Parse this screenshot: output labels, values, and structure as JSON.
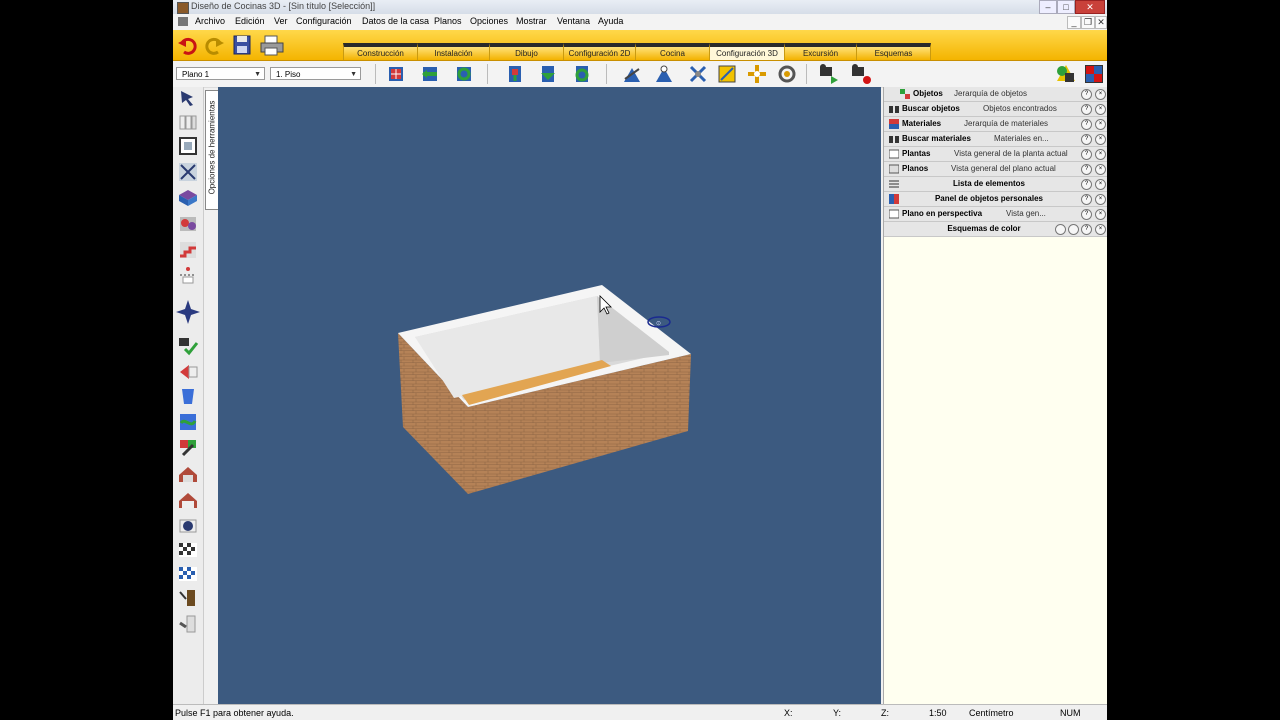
{
  "window": {
    "title": "Diseño de Cocinas 3D - [Sin título [Selección]]",
    "min_label": "–",
    "max_label": "□",
    "close_label": "✕"
  },
  "menu": {
    "items": [
      "Archivo",
      "Edición",
      "Ver",
      "Configuración",
      "Datos de la casa",
      "Planos",
      "Opciones",
      "Mostrar",
      "Ventana",
      "Ayuda"
    ],
    "mdi_min": "_",
    "mdi_restore": "❐",
    "mdi_close": "✕"
  },
  "tabs": {
    "items": [
      "Construcción",
      "Instalación",
      "Dibujo",
      "Configuración 2D",
      "Cocina",
      "Configuración 3D",
      "Excursión",
      "Esquemas"
    ],
    "active": "Configuración 3D"
  },
  "toolbar2": {
    "plan_select": "Plano 1",
    "floor_select": "1. Piso"
  },
  "left_panel": {
    "vertical_tab": "Opciones de herramientas"
  },
  "right_panel": {
    "rows": [
      {
        "label": "Objetos",
        "label2": "Jerarquía de objetos"
      },
      {
        "label": "Buscar objetos",
        "label2": "Objetos encontrados"
      },
      {
        "label": "Materiales",
        "label2": "Jerarquía de materiales"
      },
      {
        "label": "Buscar materiales",
        "label2": "Materiales en..."
      },
      {
        "label": "Plantas",
        "label2": "Vista general de la planta actual"
      },
      {
        "label": "Planos",
        "label2": "Vista general del plano actual"
      },
      {
        "label": "Lista de elementos"
      },
      {
        "label": "Panel de objetos personales"
      },
      {
        "label": "Plano en perspectiva",
        "label2": "Vista gen..."
      },
      {
        "label": "Esquemas de color"
      }
    ],
    "help_glyph": "?",
    "close_glyph": "×"
  },
  "status": {
    "help": "Pulse F1 para obtener ayuda.",
    "x_label": "X:",
    "y_label": "Y:",
    "z_label": "Z:",
    "scale": "1:50",
    "unit": "Centímetro",
    "num": "NUM"
  },
  "colors": {
    "toolbar_yellow": "#f4b400",
    "viewport_bg": "#3c5a80",
    "panel_bg": "#fffff0",
    "brick": "#b07a55"
  }
}
